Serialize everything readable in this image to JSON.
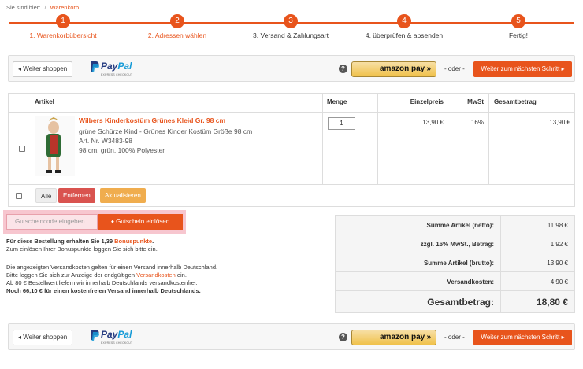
{
  "breadcrumb": {
    "prefix": "Sie sind hier:",
    "separator": "/",
    "current": "Warenkorb"
  },
  "steps": [
    {
      "num": "1",
      "label": "1. Warenkorbübersicht"
    },
    {
      "num": "2",
      "label": "2. Adressen wählen"
    },
    {
      "num": "3",
      "label": "3. Versand & Zahlungsart"
    },
    {
      "num": "4",
      "label": "4. überprüfen & absenden"
    },
    {
      "num": "5",
      "label": "Fertig!"
    }
  ],
  "toolbar": {
    "continue_label": "Weiter shoppen",
    "paypal_pay": "Pay",
    "paypal_pal": "Pal",
    "paypal_sub": "EXPRESS CHECKOUT",
    "help": "?",
    "amazon_label": "amazon pay",
    "amazon_chev": "»",
    "oder": "- oder -",
    "next_label": "Weiter zum nächsten Schritt"
  },
  "cart": {
    "headers": {
      "article": "Artikel",
      "qty": "Menge",
      "unit": "Einzelpreis",
      "vat": "MwSt",
      "total": "Gesamtbetrag"
    },
    "item": {
      "title": "Wilbers Kinderkostüm Grünes Kleid Gr. 98 cm",
      "desc": "grüne Schürze Kind - Grünes Kinder Kostüm Größe 98 cm",
      "sku": "Art. Nr. W3483-98",
      "attrs": "98 cm, grün, 100% Polyester",
      "qty": "1",
      "unit_price": "13,90 €",
      "vat": "16%",
      "total": "13,90 €"
    },
    "actions": {
      "all": "Alle",
      "remove": "Entfernen",
      "update": "Aktualisieren"
    }
  },
  "voucher": {
    "placeholder": "Gutscheincode eingeben",
    "button": "Gutschein einlösen"
  },
  "bonus": {
    "line1_pre": "Für diese Bestellung erhalten Sie 1,39 ",
    "line1_link": "Bonuspunkte",
    "line1_post": ".",
    "line2": "Zum einlösen Ihrer Bonuspunkte loggen Sie sich bitte ein."
  },
  "shipping": {
    "line1": "Die angezeigten Versandkosten gelten für einen Versand innerhalb Deutschland.",
    "line2_pre": "Bitte loggen Sie sich zur Anzeige der endgültigen ",
    "line2_link": "Versandkosten",
    "line2_post": " ein.",
    "line3": "Ab 80 € Bestellwert liefern wir innerhalb Deutschlands versandkostenfrei.",
    "line4": "Noch 66,10 € für einen kostenfreien Versand innerhalb Deutschlands."
  },
  "sums": [
    {
      "label": "Summe Artikel (netto):",
      "value": "11,98 €"
    },
    {
      "label": "zzgl. 16% MwSt., Betrag:",
      "value": "1,92 €"
    },
    {
      "label": "Summe Artikel (brutto):",
      "value": "13,90 €"
    },
    {
      "label": "Versandkosten:",
      "value": "4,90 €"
    },
    {
      "label": "Gesamtbetrag:",
      "value": "18,80 €"
    }
  ],
  "colors": {
    "accent": "#e8541c",
    "danger": "#d9534f",
    "warning": "#f0ad4e"
  }
}
